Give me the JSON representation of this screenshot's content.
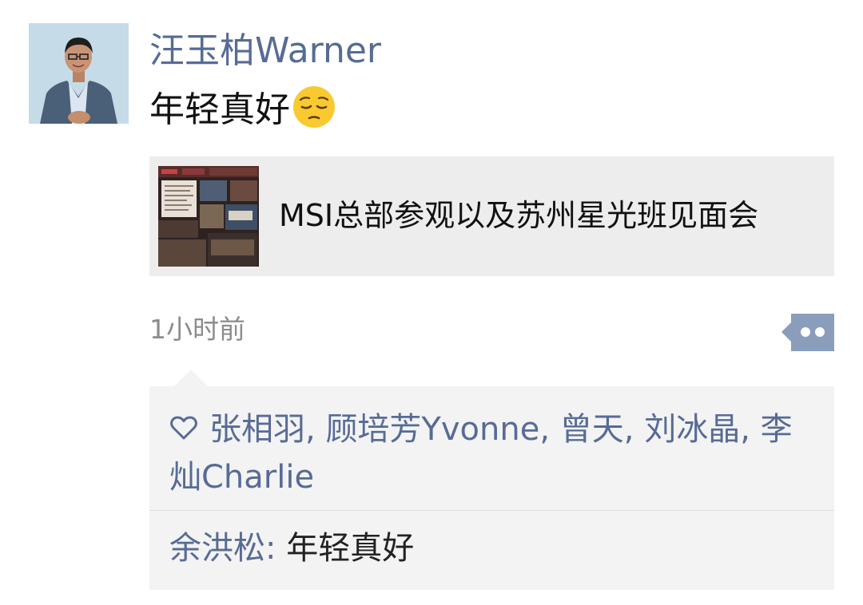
{
  "post": {
    "author": "汪玉柏Warner",
    "text": "年轻真好",
    "emoji": "pensive-face",
    "link_title": "MSI总部参观以及苏州星光班见面会",
    "time": "1小时前"
  },
  "likes": {
    "names": [
      "张相羽",
      "顾培芳Yvonne",
      "曾天",
      "刘冰晶",
      "李灿Charlie"
    ],
    "separator": ", "
  },
  "comments": [
    {
      "name": "余洪松",
      "colon": ": ",
      "text": "年轻真好"
    }
  ],
  "colors": {
    "name_link": "#576b95",
    "card_bg": "#ededed",
    "interaction_bg": "#f3f3f3",
    "more_button": "#8a9dbb",
    "timestamp": "#8c8c8c"
  },
  "icons": {
    "like": "heart-outline-icon",
    "more": "more-dots-icon"
  }
}
